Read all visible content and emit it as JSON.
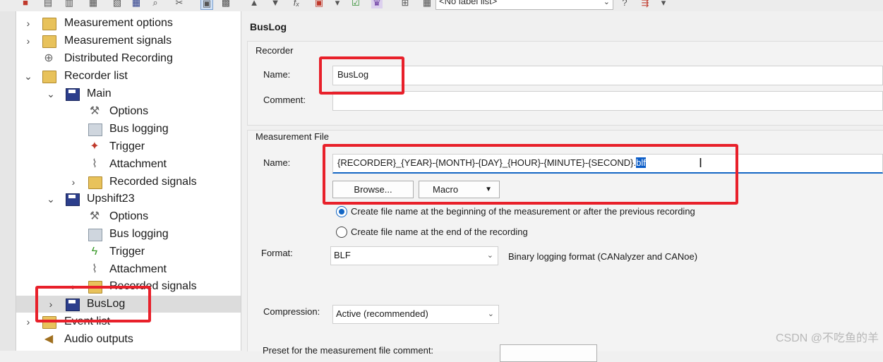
{
  "toolbar": {
    "label_list_value": "<No label list>",
    "fx_label": "fₓ"
  },
  "tree": {
    "items": [
      {
        "label": "Measurement options"
      },
      {
        "label": "Measurement signals"
      },
      {
        "label": "Distributed Recording"
      },
      {
        "label": "Recorder list"
      },
      {
        "label": "Main"
      },
      {
        "label": "Options"
      },
      {
        "label": "Bus logging"
      },
      {
        "label": "Trigger"
      },
      {
        "label": "Attachment"
      },
      {
        "label": "Recorded signals"
      },
      {
        "label": "Upshift23"
      },
      {
        "label": "Options"
      },
      {
        "label": "Bus logging"
      },
      {
        "label": "Trigger"
      },
      {
        "label": "Attachment"
      },
      {
        "label": "Recorded signals"
      },
      {
        "label": "BusLog"
      },
      {
        "label": "Event list"
      },
      {
        "label": "Audio outputs"
      }
    ]
  },
  "panel": {
    "title": "BusLog",
    "recorder": {
      "section_label": "Recorder",
      "name_label": "Name:",
      "name_value": "BusLog",
      "comment_label": "Comment:",
      "comment_value": ""
    },
    "measurement_file": {
      "section_label": "Measurement File",
      "name_label": "Name:",
      "name_value_main": "{RECORDER}_{YEAR}-{MONTH}-{DAY}_{HOUR}-{MINUTE}-{SECOND}.",
      "name_value_selected": "blf",
      "browse_label": "Browse...",
      "macro_label": "Macro",
      "radio_begin_label": "Create file name at the beginning of the measurement or after the previous recording",
      "radio_end_label": "Create file name at the end of the recording",
      "format_label": "Format:",
      "format_value": "BLF",
      "format_description": "Binary logging format (CANalyzer and CANoe)",
      "compression_label": "Compression:",
      "compression_value": "Active (recommended)",
      "preset_label": "Preset for the measurement file comment:"
    }
  },
  "watermark": "CSDN @不吃鱼的羊",
  "colors": {
    "annotation": "#e8202a",
    "selection": "#0a5cc7"
  }
}
